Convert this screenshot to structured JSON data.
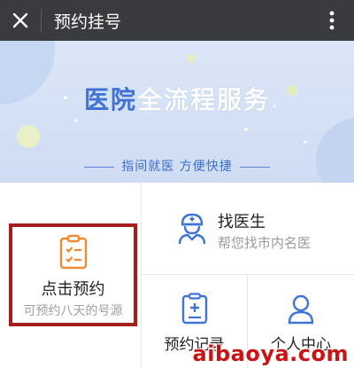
{
  "topbar": {
    "title": "预约挂号",
    "close_icon": "close-icon",
    "more_icon": "more-vertical-icon"
  },
  "banner": {
    "title_part1": "医院",
    "title_part2": "全流程服务",
    "subtitle": "指间就医 方便快捷"
  },
  "grid": {
    "appointment": {
      "label": "点击预约",
      "sub": "可预约八天的号源",
      "icon": "clipboard-icon"
    },
    "find_doctor": {
      "label": "找医生",
      "sub": "帮您找市内名医",
      "icon": "doctor-icon"
    },
    "records": {
      "label": "预约记录",
      "icon": "record-icon"
    },
    "profile": {
      "label": "个人中心",
      "icon": "user-icon"
    }
  },
  "watermark": "aibaoya.com",
  "colors": {
    "topbar": "#3a3b3f",
    "accent_blue": "#3f74d6",
    "highlight_red": "#a51d1d",
    "icon_orange": "#f08a32"
  }
}
